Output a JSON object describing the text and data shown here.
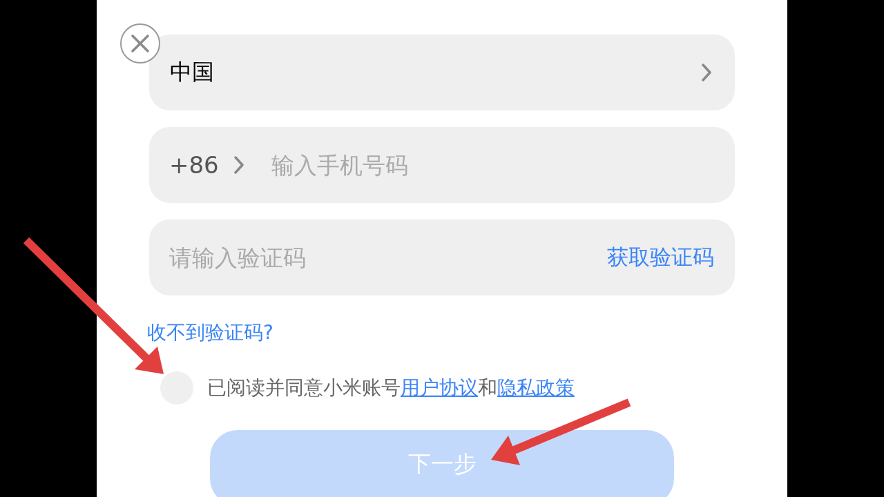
{
  "region_selector": {
    "value": "中国"
  },
  "phone_field": {
    "country_code": "+86",
    "placeholder": "输入手机号码"
  },
  "code_field": {
    "placeholder": "请输入验证码",
    "get_code_link": "获取验证码"
  },
  "no_code_link": "收不到验证码?",
  "agreement": {
    "checked": false,
    "parts": [
      {
        "kind": "text",
        "text": "已阅读并同意小米账号"
      },
      {
        "kind": "link",
        "text": "用户协议"
      },
      {
        "kind": "text",
        "text": "和"
      },
      {
        "kind": "link",
        "text": "隐私政策"
      }
    ]
  },
  "next_button": {
    "label": "下一步",
    "disabled": true
  },
  "annotations": [
    {
      "kind": "arrow"
    },
    {
      "kind": "arrow"
    }
  ]
}
